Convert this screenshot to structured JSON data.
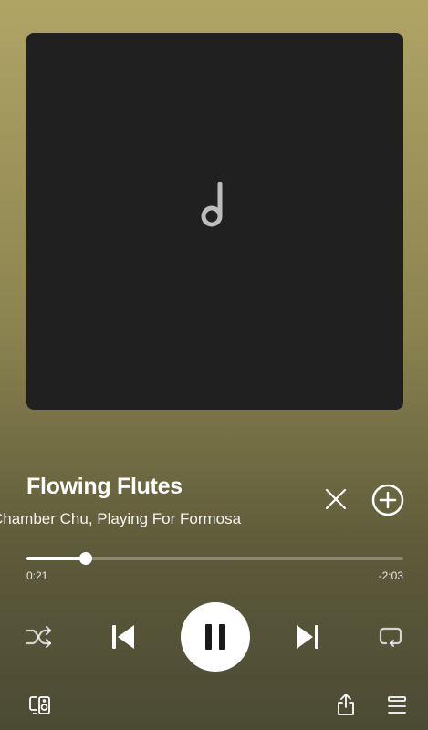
{
  "track": {
    "title": "Flowing Flutes",
    "artist": "Chamber Chu, Playing For Formosa",
    "progress_fraction": 0.157
  },
  "time": {
    "elapsed": "0:21",
    "remaining": "-2:03"
  },
  "icons": {
    "artwork_placeholder": "music-note-icon",
    "close": "close-icon",
    "add": "add-circle-icon",
    "shuffle": "shuffle-icon",
    "previous": "skip-previous-icon",
    "pause": "pause-icon",
    "next": "skip-next-icon",
    "repeat": "repeat-icon",
    "devices": "connect-device-icon",
    "share": "share-icon",
    "queue": "queue-icon"
  },
  "colors": {
    "background_top": "#b0a465",
    "background_bottom": "#4b4a34",
    "artwork_bg": "#202020"
  }
}
